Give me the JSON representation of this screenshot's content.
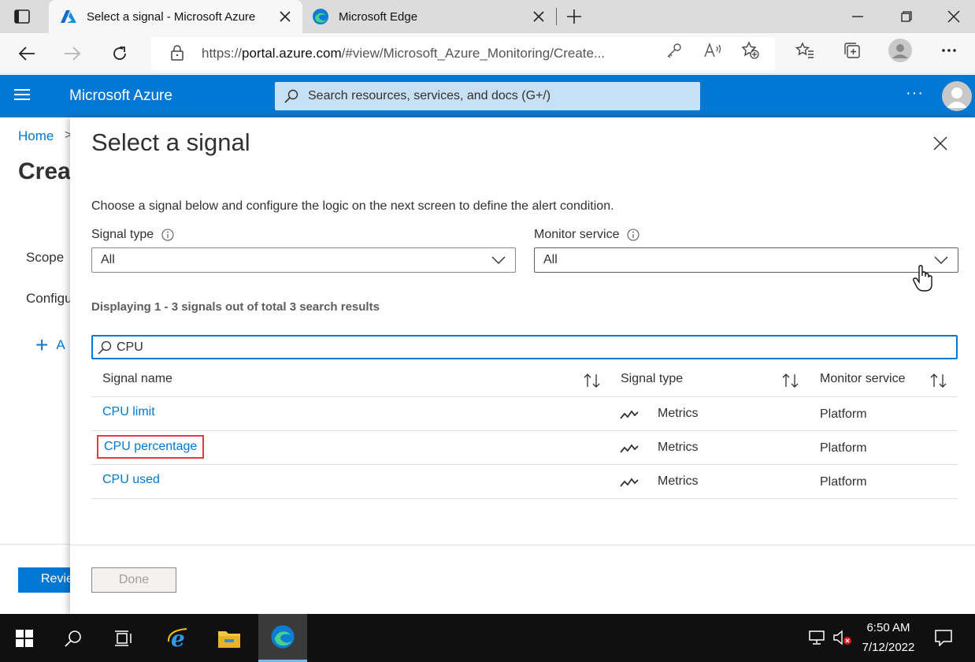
{
  "browser": {
    "tabs": [
      {
        "title": "Select a signal - Microsoft Azure",
        "icon": "azure-icon",
        "active": true
      },
      {
        "title": "Microsoft Edge",
        "icon": "edge-icon",
        "active": false
      }
    ],
    "url_prefix": "https://",
    "url_host": "portal.azure.com",
    "url_path": "/#view/Microsoft_Azure_Monitoring/Create..."
  },
  "azure_header": {
    "brand": "Microsoft Azure",
    "search_placeholder": "Search resources, services, and docs (G+/)",
    "more": "···"
  },
  "background_page": {
    "breadcrumb_home": "Home",
    "breadcrumb_sep": ">",
    "title_partial": "Crea",
    "scope_label": "Scope",
    "config_label": "Configu",
    "add_label": "A",
    "review_button": "Revie"
  },
  "blade": {
    "title": "Select a signal",
    "description": "Choose a signal below and configure the logic on the next screen to define the alert condition.",
    "signal_type_label": "Signal type",
    "signal_type_value": "All",
    "monitor_service_label": "Monitor service",
    "monitor_service_value": "All",
    "results_info": "Displaying 1 - 3 signals out of total 3 search results",
    "search_value": "CPU",
    "columns": [
      "Signal name",
      "Signal type",
      "Monitor service"
    ],
    "rows": [
      {
        "name": "CPU limit",
        "type": "Metrics",
        "service": "Platform"
      },
      {
        "name": "CPU percentage",
        "type": "Metrics",
        "service": "Platform"
      },
      {
        "name": "CPU used",
        "type": "Metrics",
        "service": "Platform"
      }
    ],
    "done_button": "Done"
  },
  "taskbar": {
    "time": "6:50 AM",
    "date": "7/12/2022"
  },
  "colors": {
    "azure_blue": "#0078d4",
    "highlight_red": "#e43c3c"
  }
}
